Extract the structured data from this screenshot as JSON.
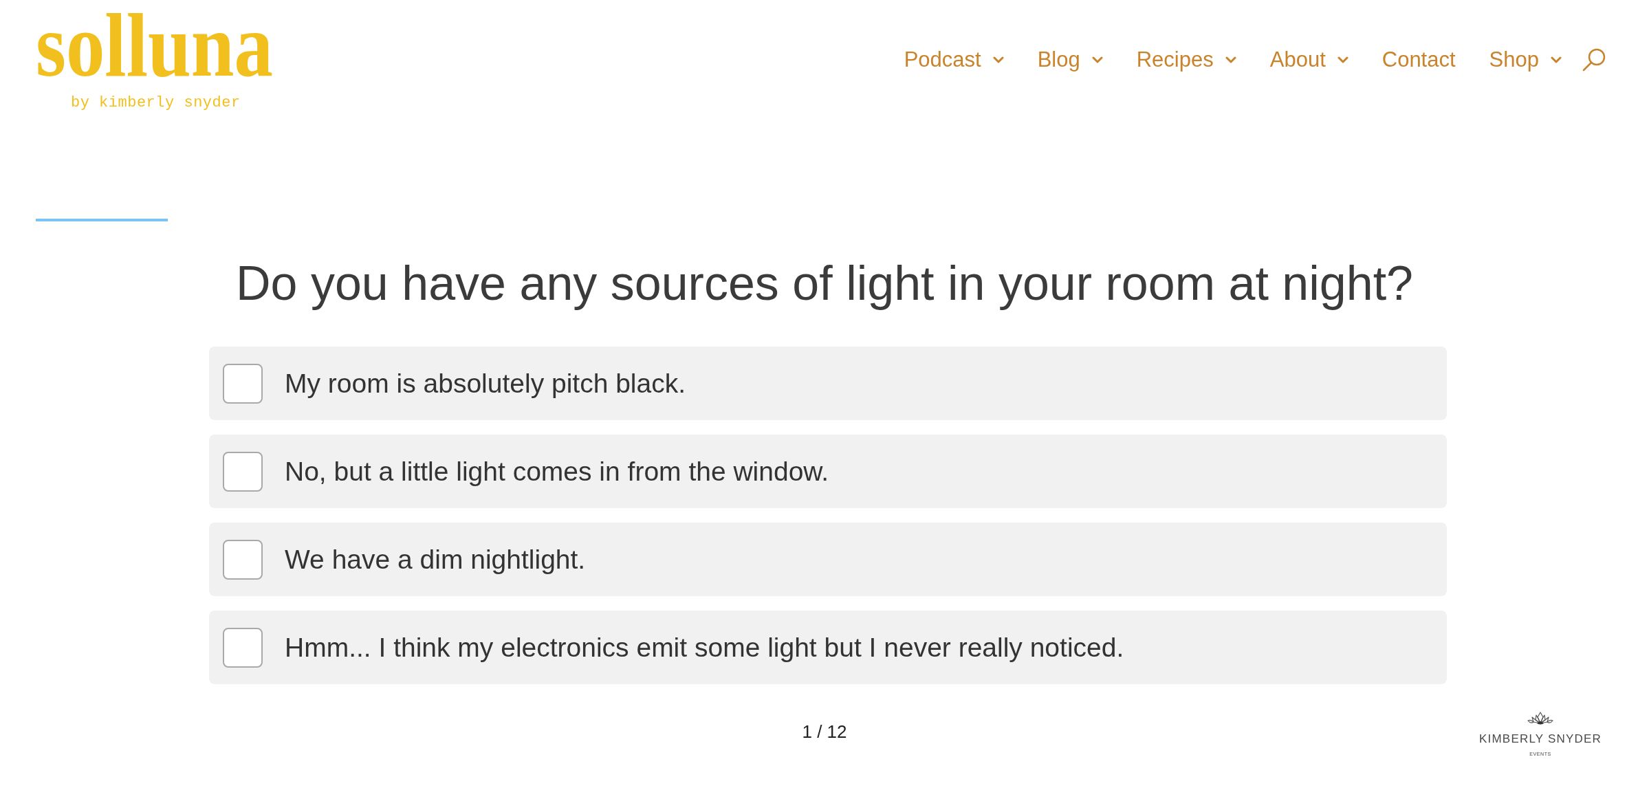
{
  "header": {
    "logo": {
      "wordmark": "solluna",
      "tagline": "by kimberly snyder"
    },
    "nav": [
      {
        "label": "Podcast",
        "kind": "dropdown"
      },
      {
        "label": "Blog",
        "kind": "dropdown"
      },
      {
        "label": "Recipes",
        "kind": "dropdown"
      },
      {
        "label": "About",
        "kind": "dropdown"
      },
      {
        "label": "Contact",
        "kind": "link"
      },
      {
        "label": "Shop",
        "kind": "dropdown"
      }
    ]
  },
  "quiz": {
    "question": "Do you have any sources of light in your room at night?",
    "options": [
      {
        "label": "My room is absolutely pitch black.",
        "checked": false
      },
      {
        "label": "No, but a little light comes in from the window.",
        "checked": false
      },
      {
        "label": "We have a dim nightlight.",
        "checked": false
      },
      {
        "label": "Hmm... I think my electronics emit some light but I never really noticed.",
        "checked": false
      }
    ],
    "progress": "1 / 12"
  },
  "badge": {
    "name": "KIMBERLY SNYDER",
    "subtitle": "EVENTS"
  }
}
